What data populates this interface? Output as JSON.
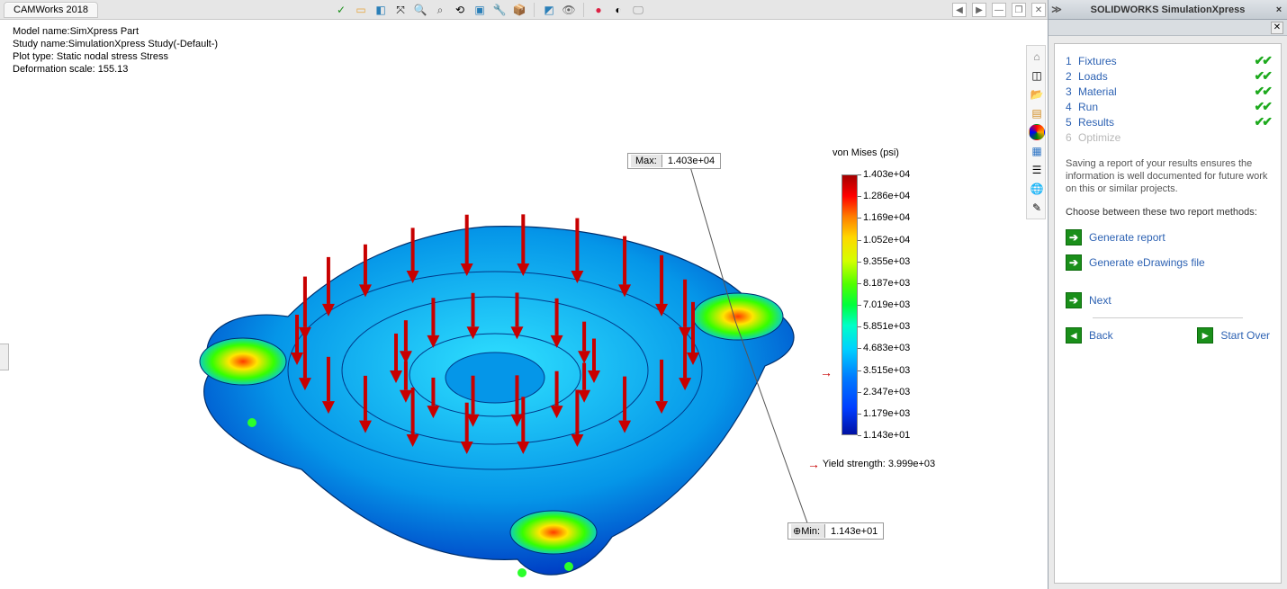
{
  "menubar": {
    "tab": "CAMWorks 2018"
  },
  "toolbar_icons": [
    {
      "name": "accept-icon",
      "glyph": "✓",
      "cls": "ic-check"
    },
    {
      "name": "document-icon",
      "glyph": "▭",
      "cls": "ic-doc"
    },
    {
      "name": "cube-icon",
      "glyph": "◧",
      "cls": "ic-cube"
    },
    {
      "name": "axis-icon",
      "glyph": "⤧",
      "cls": ""
    },
    {
      "name": "magnify-icon",
      "glyph": "🔍",
      "cls": "ic-lens"
    },
    {
      "name": "zoom-area-icon",
      "glyph": "⌕",
      "cls": "ic-lens"
    },
    {
      "name": "rotate-icon",
      "glyph": "⟲",
      "cls": ""
    },
    {
      "name": "box-icon",
      "glyph": "▣",
      "cls": "ic-cube"
    },
    {
      "name": "wrench-icon",
      "glyph": "🔧",
      "cls": ""
    },
    {
      "name": "package-icon",
      "glyph": "📦",
      "cls": ""
    },
    {
      "name": "sep1",
      "glyph": "",
      "cls": "sep"
    },
    {
      "name": "render-cube-icon",
      "glyph": "◩",
      "cls": "ic-cube"
    },
    {
      "name": "visibility-icon",
      "glyph": "👁",
      "cls": "ic-eye"
    },
    {
      "name": "sep2",
      "glyph": "",
      "cls": "sep"
    },
    {
      "name": "appearance-icon",
      "glyph": "●",
      "cls": "ic-paint"
    },
    {
      "name": "scene-icon",
      "glyph": "◐",
      "cls": ""
    },
    {
      "name": "display-icon",
      "glyph": "🖵",
      "cls": "ic-screen"
    }
  ],
  "window_controls": [
    "◀",
    "▶",
    "—",
    "❐",
    "✕"
  ],
  "info": {
    "line1": "Model name:SimXpress Part",
    "line2": "Study name:SimulationXpress Study(-Default-)",
    "line3": "Plot type: Static nodal stress Stress",
    "line4": "Deformation scale: 155.13"
  },
  "callouts": {
    "max_label": "Max:",
    "max_value": "1.403e+04",
    "min_label": "Min:",
    "min_value": "1.143e+01"
  },
  "legend": {
    "title": "von Mises (psi)",
    "ticks": [
      "1.403e+04",
      "1.286e+04",
      "1.169e+04",
      "1.052e+04",
      "9.355e+03",
      "8.187e+03",
      "7.019e+03",
      "5.851e+03",
      "4.683e+03",
      "3.515e+03",
      "2.347e+03",
      "1.179e+03",
      "1.143e+01"
    ],
    "yield_label": "Yield strength: 3.999e+03"
  },
  "side_icons": [
    {
      "name": "home-icon",
      "glyph": "⌂",
      "cls": "ic-home"
    },
    {
      "name": "part-tree-icon",
      "glyph": "◫",
      "cls": ""
    },
    {
      "name": "open-folder-icon",
      "glyph": "📂",
      "cls": "ic-folder"
    },
    {
      "name": "view-palette-icon",
      "glyph": "▤",
      "cls": "ic-orange"
    },
    {
      "name": "appearances-icon",
      "glyph": "",
      "cls": "ic-multi"
    },
    {
      "name": "decals-icon",
      "glyph": "▦",
      "cls": "ic-blue"
    },
    {
      "name": "resources-icon",
      "glyph": "☰",
      "cls": ""
    },
    {
      "name": "forum-icon",
      "glyph": "🌐",
      "cls": "ic-globe"
    },
    {
      "name": "sketch-tool-icon",
      "glyph": "✎",
      "cls": ""
    }
  ],
  "sim": {
    "title": "SOLIDWORKS SimulationXpress",
    "steps": [
      {
        "n": "1",
        "label": "Fixtures",
        "done": true
      },
      {
        "n": "2",
        "label": "Loads",
        "done": true
      },
      {
        "n": "3",
        "label": "Material",
        "done": true
      },
      {
        "n": "4",
        "label": "Run",
        "done": true
      },
      {
        "n": "5",
        "label": "Results",
        "done": true
      },
      {
        "n": "6",
        "label": "Optimize",
        "done": false,
        "disabled": true
      }
    ],
    "para1": "Saving a report of your results ensures the information is well documented for future work on this or similar projects.",
    "para2": "Choose between these two report methods:",
    "link_report": "Generate report",
    "link_edraw": "Generate eDrawings file",
    "link_next": "Next",
    "link_back": "Back",
    "link_start": "Start Over"
  }
}
